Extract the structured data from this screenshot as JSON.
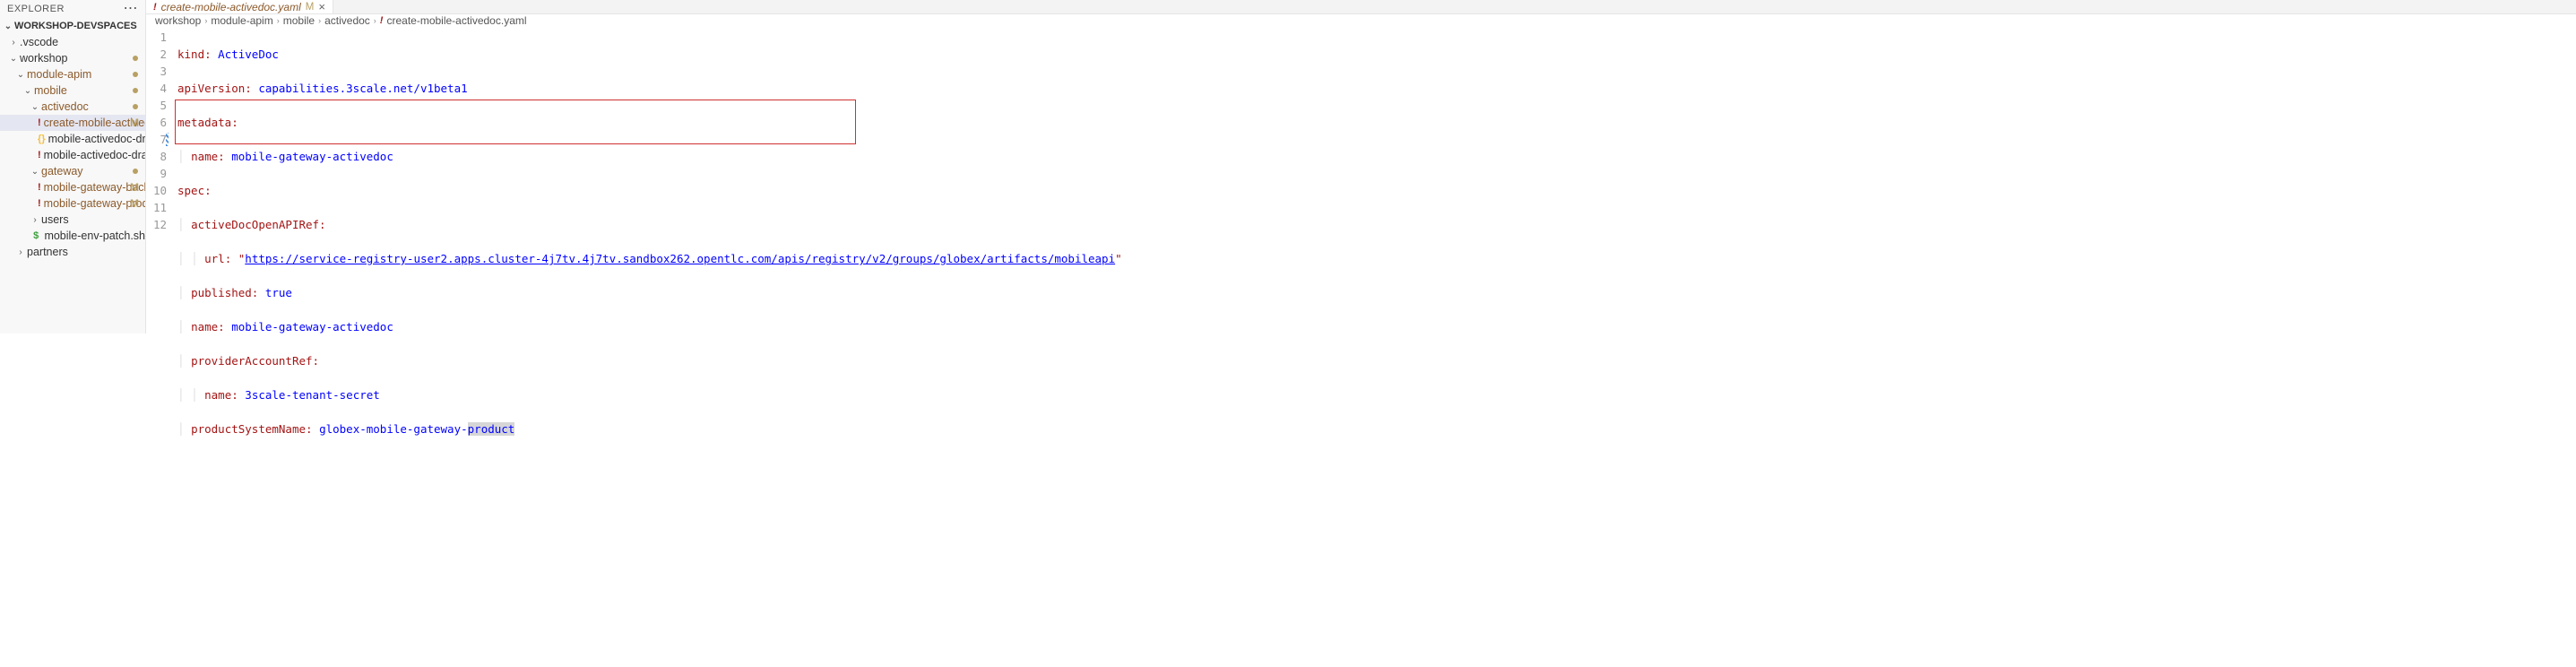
{
  "explorer": {
    "title": "EXPLORER"
  },
  "workspace": {
    "title": "WORKSHOP-DEVSPACES"
  },
  "tree": {
    "vscode": ".vscode",
    "workshop": "workshop",
    "module_apim": "module-apim",
    "mobile": "mobile",
    "activedoc": "activedoc",
    "create_yaml": "create-mobile-activedoc.yaml",
    "draft_json": "mobile-activedoc-draft.json",
    "draft_yaml": "mobile-activedoc-draft.yaml",
    "gateway": "gateway",
    "backend_yaml": "mobile-gateway-backend.yaml",
    "product_yaml": "mobile-gateway-product.yaml",
    "users": "users",
    "env_patch": "mobile-env-patch.sh",
    "partners": "partners",
    "m": "M"
  },
  "tab": {
    "label": "create-mobile-activedoc.yaml",
    "m": "M"
  },
  "breadcrumb": {
    "p1": "workshop",
    "p2": "module-apim",
    "p3": "mobile",
    "p4": "activedoc",
    "p5": "create-mobile-activedoc.yaml"
  },
  "code": {
    "l1_k": "kind:",
    "l1_v": "ActiveDoc",
    "l2_k": "apiVersion:",
    "l2_v": "capabilities.3scale.net/v1beta1",
    "l3_k": "metadata:",
    "l4_k": "name:",
    "l4_v": "mobile-gateway-activedoc",
    "l5_k": "spec:",
    "l6_k": "activeDocOpenAPIRef:",
    "l7_k": "url:",
    "l7_q1": "\"",
    "l7_v": "https://service-registry-user2.apps.cluster-4j7tv.4j7tv.sandbox262.opentlc.com/apis/registry/v2/groups/globex/artifacts/mobileapi",
    "l7_q2": "\"",
    "l8_k": "published:",
    "l8_v": "true",
    "l9_k": "name:",
    "l9_v": "mobile-gateway-activedoc",
    "l10_k": "providerAccountRef:",
    "l11_k": "name:",
    "l11_v": "3scale-tenant-secret",
    "l12_k": "productSystemName:",
    "l12_v1": "globex-mobile-gateway-",
    "l12_v2": "product"
  },
  "lines": {
    "n1": "1",
    "n2": "2",
    "n3": "3",
    "n4": "4",
    "n5": "5",
    "n6": "6",
    "n7": "7",
    "n8": "8",
    "n9": "9",
    "n10": "10",
    "n11": "11",
    "n12": "12"
  }
}
